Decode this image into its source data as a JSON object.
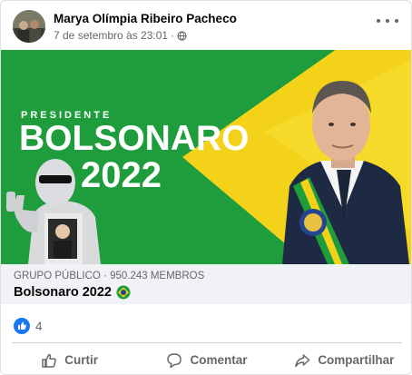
{
  "post": {
    "author": "Marya Olímpia Ribeiro Pacheco",
    "date": "7 de setembro às 23:01",
    "separator": "·",
    "privacy_icon": "globe-icon",
    "more_icon": "more-options-icon"
  },
  "banner": {
    "top_text": "PRESIDENTE",
    "name_text": "BOLSONARO",
    "year_text": "2022",
    "colors": {
      "green": "#1f9d3c",
      "yellow": "#f4d21a",
      "blue": "#24458f"
    }
  },
  "group": {
    "meta": "GRUPO PÚBLICO · 950.243 MEMBROS",
    "name": "Bolsonaro 2022",
    "emoji_icon": "brazil-flag-icon"
  },
  "reactions": {
    "icon": "like-reaction-icon",
    "count": "4"
  },
  "actions": {
    "like_label": "Curtir",
    "comment_label": "Comentar",
    "share_label": "Compartilhar"
  },
  "colors": {
    "secondary_text": "#65676b",
    "facebook_blue": "#1877f2",
    "group_bg": "#f0f2f5"
  }
}
